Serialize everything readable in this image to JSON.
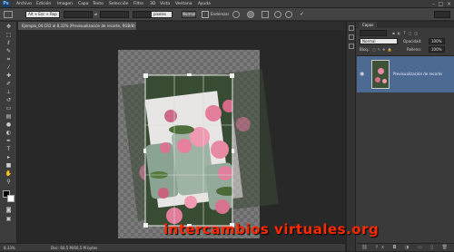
{
  "menubar": {
    "logo": "Ps",
    "items": [
      "Archivo",
      "Edición",
      "Imagen",
      "Capa",
      "Texto",
      "Selección",
      "Filtro",
      "3D",
      "Vista",
      "Ventana",
      "Ayuda"
    ]
  },
  "options": {
    "style_value": "Alt + Esc + Rep",
    "mode_value": "píxeles",
    "normal_label": "Normal",
    "refine_label": "Enderezar"
  },
  "document": {
    "tab_title": "Ejemplo_04.CR2 al 8,33% (Previsualización de recorte, RGB/8)"
  },
  "status": {
    "zoom": "8,33%",
    "doc_info": "Doc: 60,5 M/60,5 M bytes"
  },
  "layers_panel": {
    "tab": "Capas",
    "blend_mode": "Normal",
    "opacity_label": "Opacidad:",
    "opacity_value": "100%",
    "lock_label": "Bloq.:",
    "fill_label": "Relleno:",
    "fill_value": "100%",
    "layer_name": "Previsualización de recorte"
  },
  "watermark": "intercambios virtuales.org",
  "colors": {
    "accent": "#ff2a00",
    "layer_selected": "#4c6a92"
  }
}
